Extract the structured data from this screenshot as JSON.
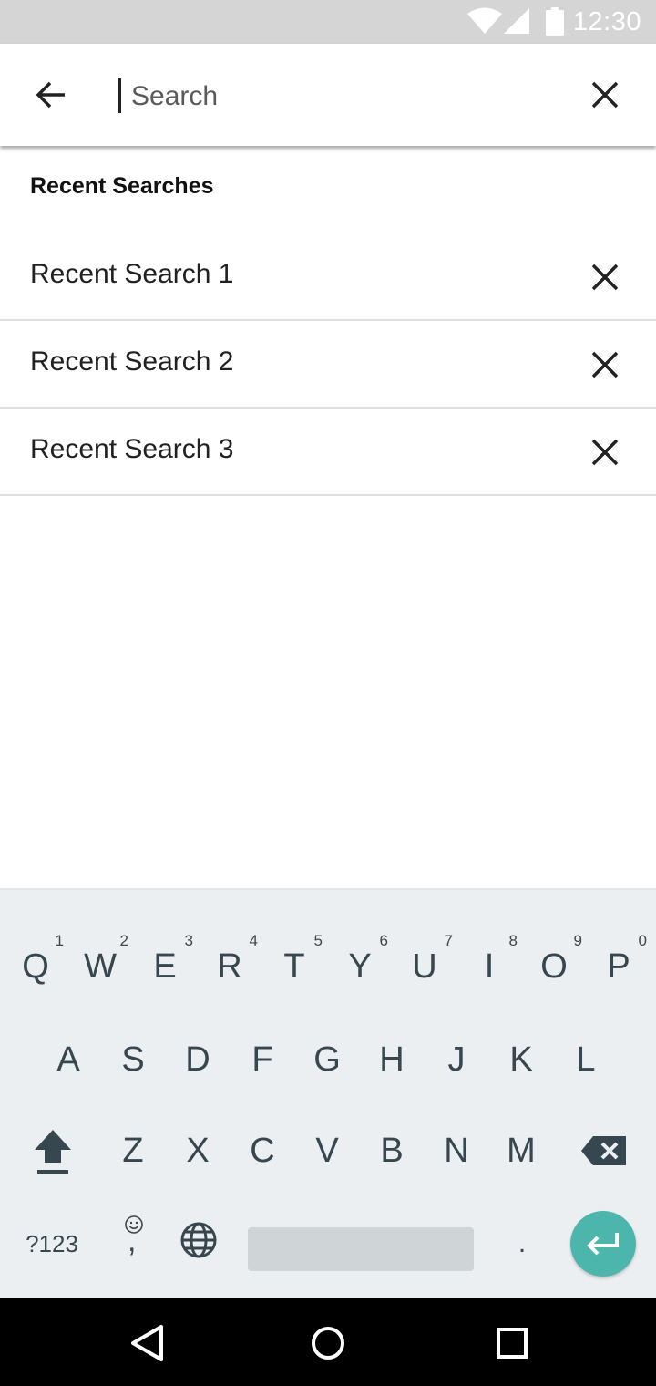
{
  "status_bar": {
    "time": "12:30",
    "icons": [
      "wifi-icon",
      "signal-icon",
      "battery-icon"
    ]
  },
  "search": {
    "placeholder": "Search",
    "value": "",
    "back_icon": "arrow-left-icon",
    "clear_icon": "close-icon"
  },
  "recent": {
    "title": "Recent Searches",
    "items": [
      {
        "label": "Recent Search 1"
      },
      {
        "label": "Recent Search 2"
      },
      {
        "label": "Recent Search 3"
      }
    ]
  },
  "keyboard": {
    "row1": [
      {
        "key": "Q",
        "hint": "1"
      },
      {
        "key": "W",
        "hint": "2"
      },
      {
        "key": "E",
        "hint": "3"
      },
      {
        "key": "R",
        "hint": "4"
      },
      {
        "key": "T",
        "hint": "5"
      },
      {
        "key": "Y",
        "hint": "6"
      },
      {
        "key": "U",
        "hint": "7"
      },
      {
        "key": "I",
        "hint": "8"
      },
      {
        "key": "O",
        "hint": "9"
      },
      {
        "key": "P",
        "hint": "0"
      }
    ],
    "row2": [
      "A",
      "S",
      "D",
      "F",
      "G",
      "H",
      "J",
      "K",
      "L"
    ],
    "row3": [
      "Z",
      "X",
      "C",
      "V",
      "B",
      "N",
      "M"
    ],
    "symbols_label": "?123",
    "comma_label": ",",
    "period_label": ".",
    "accent_color": "#4db6ac"
  },
  "nav_bar": {
    "icons": [
      "back-triangle-icon",
      "home-circle-icon",
      "recents-square-icon"
    ]
  }
}
